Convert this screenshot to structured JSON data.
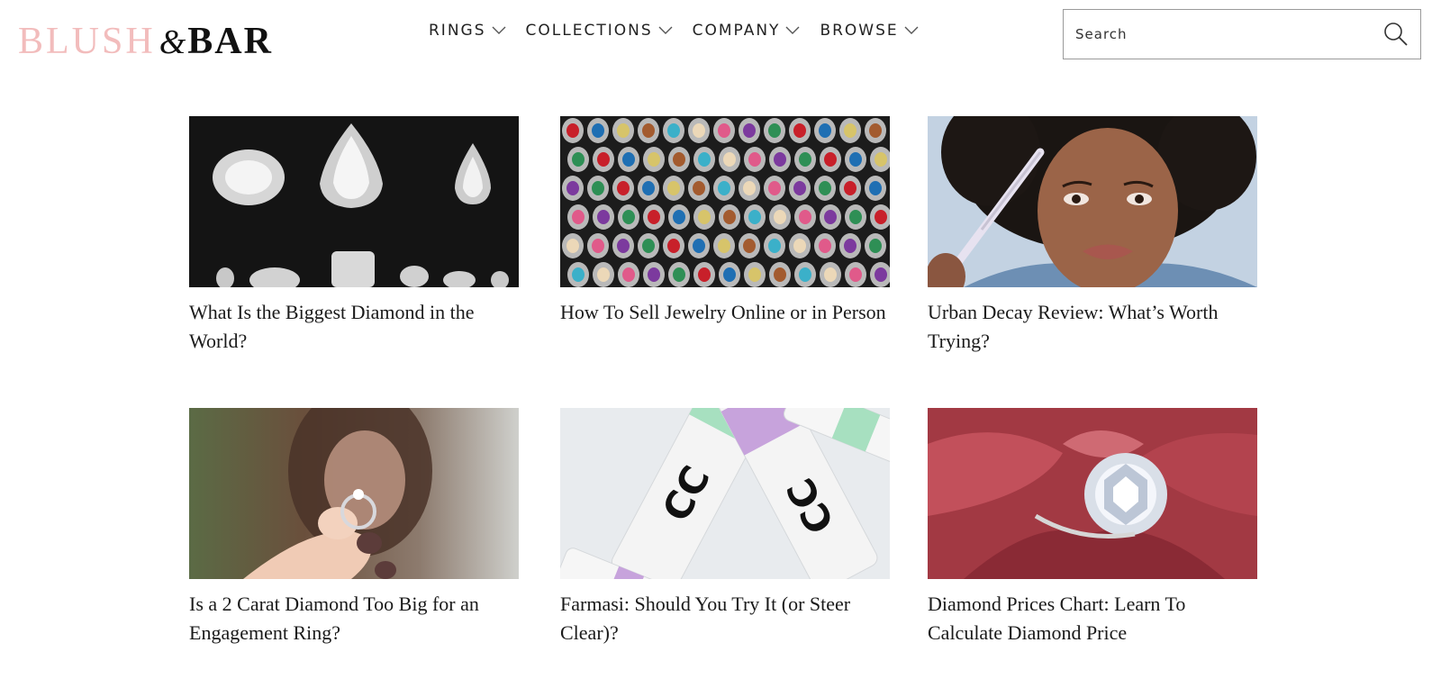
{
  "brand": {
    "part1": "BLUSH",
    "amp": "&",
    "part2": "BAR",
    "accent": "#f2bcbc"
  },
  "nav": {
    "items": [
      {
        "label": "RINGS"
      },
      {
        "label": "COLLECTIONS"
      },
      {
        "label": "COMPANY"
      },
      {
        "label": "BROWSE"
      }
    ]
  },
  "search": {
    "placeholder": "Search",
    "value": ""
  },
  "articles": [
    {
      "title": "What Is the Biggest Diamond in the World?",
      "image": "loose diamonds on black"
    },
    {
      "title": "How To Sell Jewelry Online or in Person",
      "image": "rows of gemstone rings"
    },
    {
      "title": "Urban Decay Review: What’s Worth Trying?",
      "image": "woman applying eyeliner"
    },
    {
      "title": "Is a 2 Carat Diamond Too Big for an Engagement Ring?",
      "image": "hand holding diamond ring"
    },
    {
      "title": "Farmasi: Should You Try It (or Steer Clear)?",
      "image": "cc cream tubes"
    },
    {
      "title": "Diamond Prices Chart: Learn To Calculate Diamond Price",
      "image": "diamond ring on red fabric"
    }
  ]
}
